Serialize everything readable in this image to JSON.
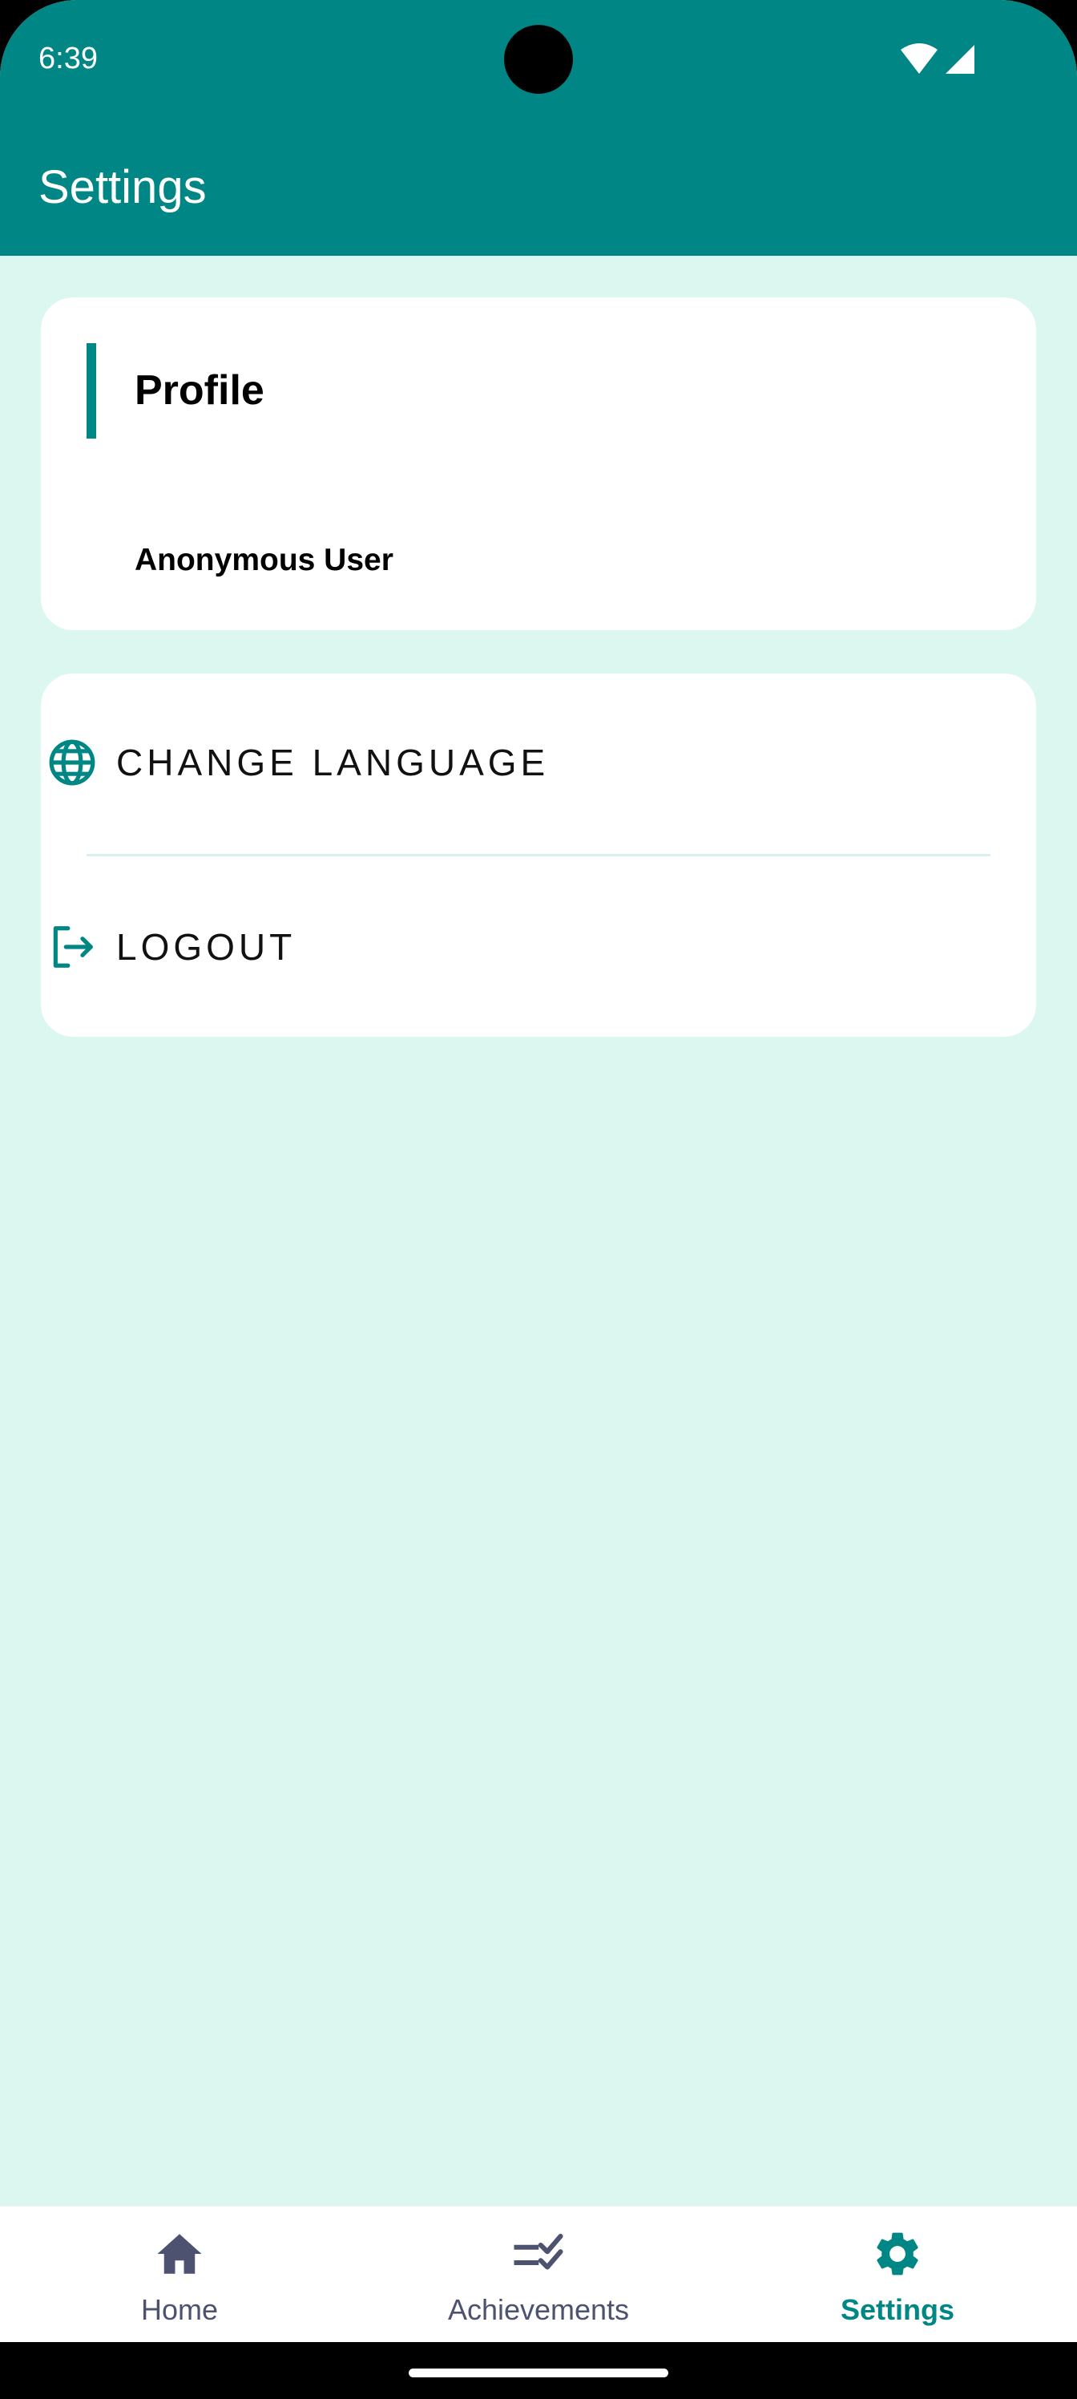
{
  "status_bar": {
    "time": "6:39",
    "icons": [
      "wifi-icon",
      "cell-signal-icon"
    ]
  },
  "app_bar": {
    "title": "Settings",
    "color": "#008785"
  },
  "profile": {
    "title": "Profile",
    "user_name": "Anonymous User"
  },
  "actions": {
    "change_language": {
      "label": "CHANGE LANGUAGE",
      "icon": "globe-icon"
    },
    "logout": {
      "label": "LOGOUT",
      "icon": "logout-icon"
    }
  },
  "bottom_nav": {
    "items": [
      {
        "label": "Home",
        "icon": "home-icon",
        "active": false
      },
      {
        "label": "Achievements",
        "icon": "checklist-icon",
        "active": false
      },
      {
        "label": "Settings",
        "icon": "gear-icon",
        "active": true
      }
    ],
    "active_color": "#008785",
    "inactive_color": "#4c5270"
  },
  "colors": {
    "background": "#dcf6f0",
    "accent": "#008785",
    "card": "#ffffff"
  }
}
